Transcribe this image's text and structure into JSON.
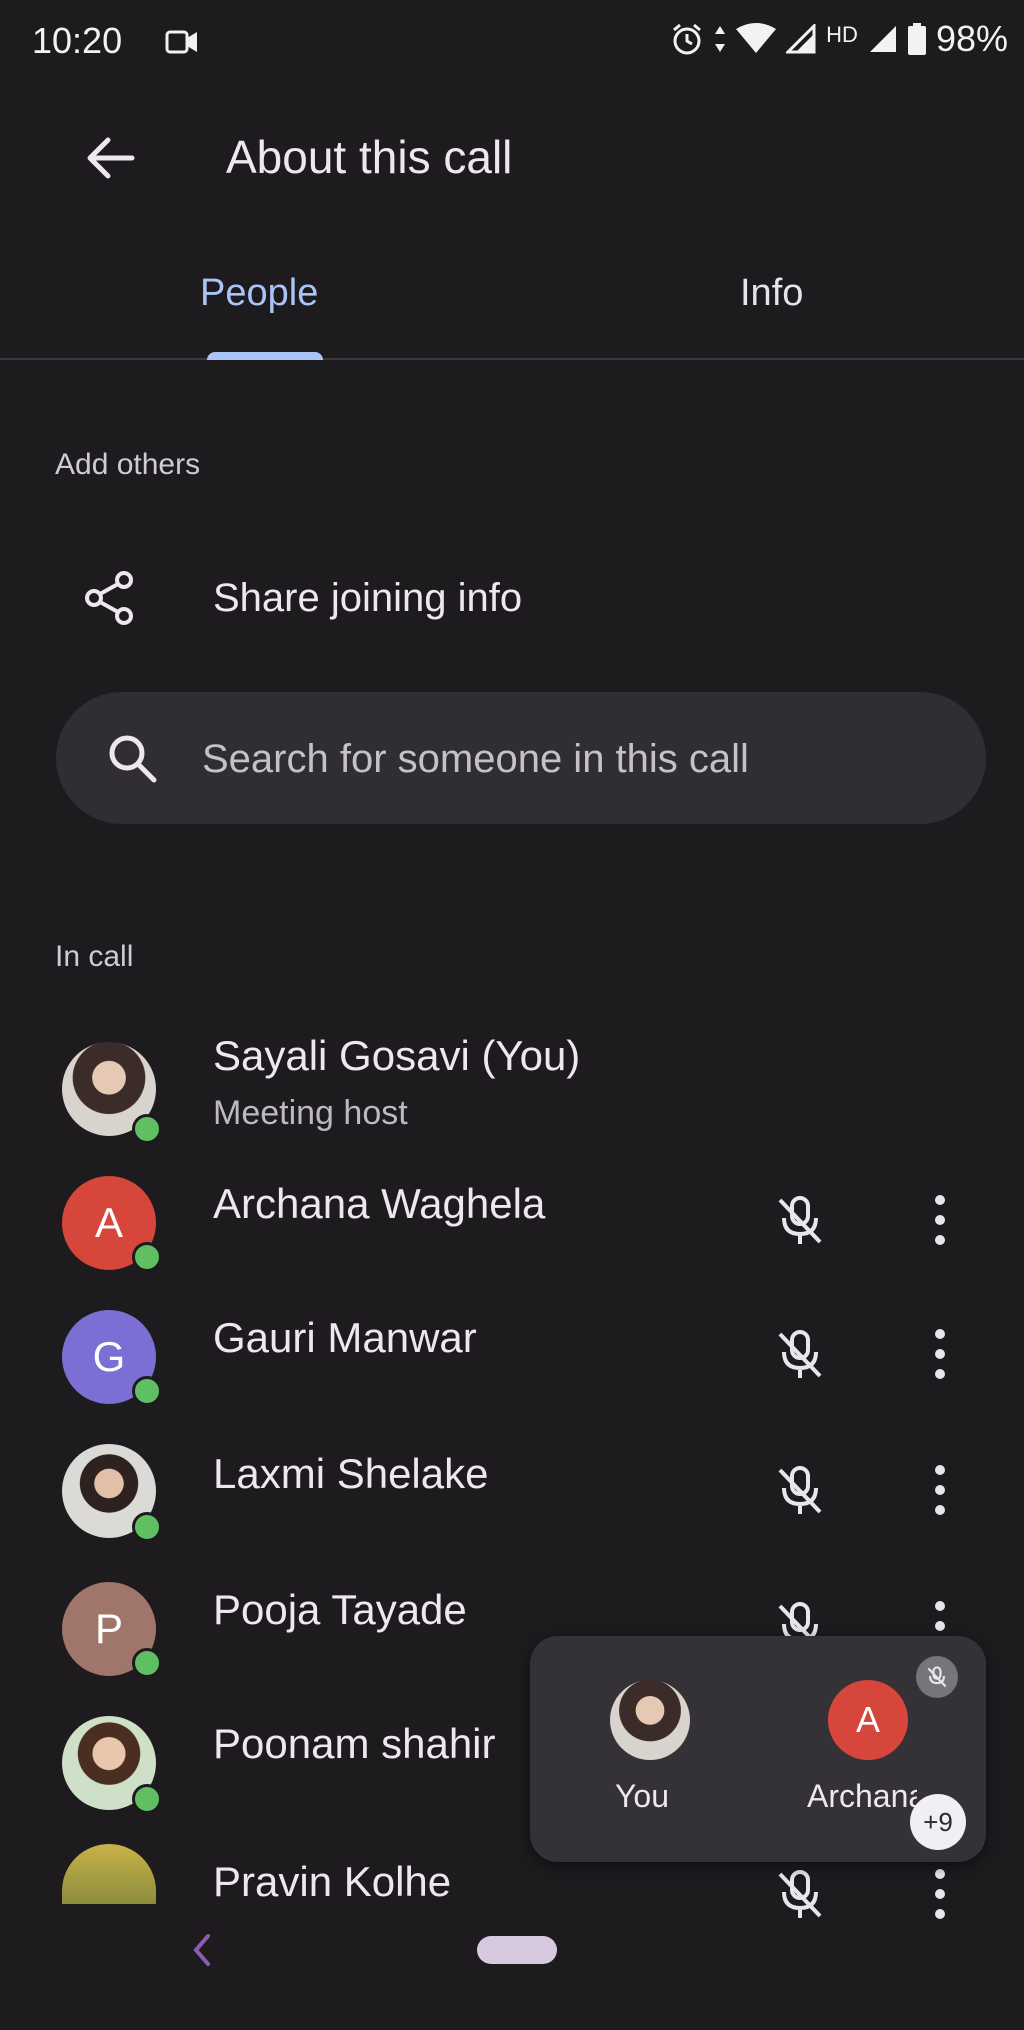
{
  "status_bar": {
    "time": "10:20",
    "network": "HD",
    "battery": "98%"
  },
  "app_bar": {
    "title": "About this call"
  },
  "tabs": [
    {
      "label": "People",
      "active": true
    },
    {
      "label": "Info",
      "active": false
    }
  ],
  "add_others": {
    "section_label": "Add others",
    "share_label": "Share joining info"
  },
  "search": {
    "placeholder": "Search for someone in this call"
  },
  "in_call": {
    "section_label": "In call",
    "participants": [
      {
        "name": "Sayali Gosavi (You)",
        "subtitle": "Meeting host",
        "avatar": "photo",
        "muted": false
      },
      {
        "name": "Archana Waghela",
        "initial": "A",
        "avatar_color": "#d6463a",
        "muted": true
      },
      {
        "name": "Gauri Manwar",
        "initial": "G",
        "avatar_color": "#7b6fd6",
        "muted": true
      },
      {
        "name": "Laxmi Shelake",
        "avatar": "photo",
        "muted": true
      },
      {
        "name": "Pooja Tayade",
        "initial": "P",
        "avatar_color": "#a0766a",
        "muted": true
      },
      {
        "name": "Poonam shahir",
        "avatar": "photo",
        "muted": true
      },
      {
        "name": "Pravin Kolhe",
        "avatar": "photo",
        "muted": true
      }
    ]
  },
  "pip": {
    "you_label": "You",
    "other_initial": "A",
    "other_label": "Archana",
    "more_count": "+9"
  },
  "colors": {
    "background": "#1d1b1e",
    "accent": "#a9c4f5",
    "presence": "#5fbf62"
  }
}
